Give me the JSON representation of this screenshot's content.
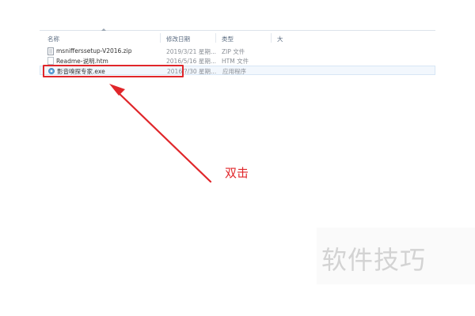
{
  "columns": {
    "name": "名称",
    "date_modified": "修改日期",
    "type": "类型",
    "size": "大"
  },
  "files": [
    {
      "name": "msnifferssetup-V2016.zip",
      "date": "2019/3/21 星期...",
      "type": "ZIP 文件",
      "icon": "zip-file-icon"
    },
    {
      "name": "Readme-说明.htm",
      "date": "2016/5/16 星期...",
      "type": "HTM 文件",
      "icon": "htm-file-icon"
    },
    {
      "name": "影音嗅探专家.exe",
      "date": "2016/?/30 星期...",
      "type": "应用程序",
      "icon": "exe-app-icon"
    }
  ],
  "annotation": {
    "text": "双击",
    "color": "#e0262a"
  },
  "watermark": {
    "text": "软件技巧"
  },
  "colors": {
    "highlight": "#e0262a",
    "header_text": "#5a6b80",
    "selection_bg": "#f2f7fd"
  }
}
